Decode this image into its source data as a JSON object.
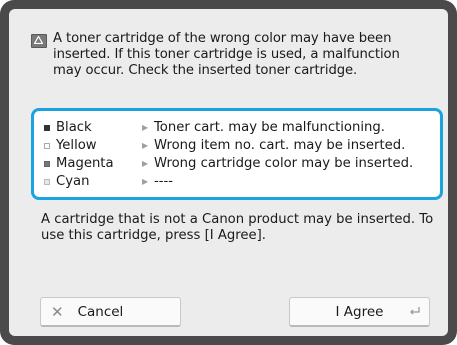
{
  "warning": {
    "icon": "warning-icon",
    "text": "A toner cartridge of the wrong color may have been inserted. If this toner cartridge is used, a malfunction may occur. Check the inserted toner cartridge."
  },
  "cartridges": [
    {
      "name": "Black",
      "message": "Toner cart. may be malfunctioning.",
      "swatch": "#333333"
    },
    {
      "name": "Yellow",
      "message": "Wrong item no. cart. may be inserted.",
      "swatch": "#ffffff"
    },
    {
      "name": "Magenta",
      "message": "Wrong cartridge color may be inserted.",
      "swatch": "#777777"
    },
    {
      "name": "Cyan",
      "message": "----",
      "swatch": "#e6e6e6"
    }
  ],
  "info_text": "A cartridge that is not a Canon product may be inserted. To use this cartridge, press [I Agree].",
  "buttons": {
    "cancel_label": "Cancel",
    "agree_label": "I Agree"
  },
  "colors": {
    "accent_border": "#1aa3e0",
    "frame": "#4a4a4a",
    "panel": "#ececec"
  }
}
